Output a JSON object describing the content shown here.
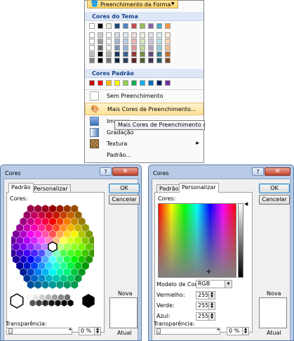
{
  "menu": {
    "button_label": "Preenchimento da Forma",
    "theme_header": "Cores do Tema",
    "standard_header": "Cores Padrão",
    "items": [
      {
        "label": "Sem Preenchimento"
      },
      {
        "label": "Mais Cores de Preenchimento..."
      },
      {
        "label": "Imagem..."
      },
      {
        "label": "Gradação"
      },
      {
        "label": "Textura"
      },
      {
        "label": "Padrão..."
      }
    ],
    "tooltip": "Mais Cores de Preenchimento da Forma",
    "theme_colors": [
      "#ffffff",
      "#000000",
      "#eeece1",
      "#1f497d",
      "#4f81bd",
      "#c0504d",
      "#9bbb59",
      "#8064a2",
      "#4bacc6",
      "#f79646"
    ],
    "standard_colors": [
      "#c00000",
      "#ff0000",
      "#ffc000",
      "#ffff00",
      "#92d050",
      "#00b050",
      "#00b0f0",
      "#0070c0",
      "#002060",
      "#7030a0"
    ]
  },
  "dialog_standard": {
    "title": "Cores",
    "help": "?",
    "close": "✕",
    "tab_standard": "Padrão",
    "tab_custom": "Personalizar",
    "colors_label": "Cores:",
    "ok": "OK",
    "cancel": "Cancelar",
    "new_label": "Nova",
    "current_label": "Atual",
    "transparency_label": "Transparência:",
    "transparency_value": "0 %"
  },
  "dialog_custom": {
    "title": "Cores",
    "help": "?",
    "close": "✕",
    "tab_standard": "Padrão",
    "tab_custom": "Personalizar",
    "colors_label": "Cores:",
    "ok": "OK",
    "cancel": "Cancelar",
    "color_model_label": "Modelo de Cores:",
    "color_model_value": "RGB",
    "red_label": "Vermelho:",
    "red_value": "255",
    "green_label": "Verde:",
    "green_value": "255",
    "blue_label": "Azul:",
    "blue_value": "255",
    "new_label": "Nova",
    "current_label": "Atual",
    "transparency_label": "Transparência:",
    "transparency_value": "0 %"
  }
}
